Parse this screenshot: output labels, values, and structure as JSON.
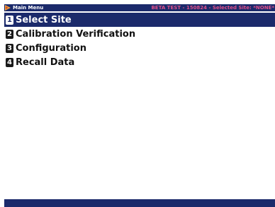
{
  "title_bar": {
    "title": "Main Menu",
    "status": "BETA TEST - 150824 - Selected Site: *NONE*",
    "icon": "app-flag-icon"
  },
  "menu": {
    "items": [
      {
        "number": "1",
        "label": "Select Site",
        "selected": true
      },
      {
        "number": "2",
        "label": "Calibration Verification",
        "selected": false
      },
      {
        "number": "3",
        "label": "Configuration",
        "selected": false
      },
      {
        "number": "4",
        "label": "Recall Data",
        "selected": false
      }
    ]
  },
  "colors": {
    "bar_background": "#1b2a6b",
    "status_text": "#e0508a",
    "selection_background": "#1b2a6b"
  }
}
